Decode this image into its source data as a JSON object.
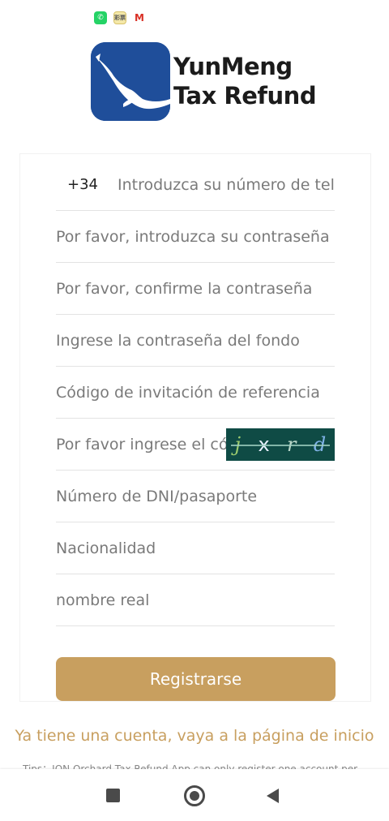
{
  "status_bar": {
    "icons": [
      "whatsapp-icon",
      "app-icon",
      "gmail-icon"
    ],
    "app_icon_text": "彩票",
    "gmail_icon_text": "M"
  },
  "logo": {
    "line1": "YunMeng",
    "line2": "Tax Refund"
  },
  "form": {
    "phone_prefix": "+34",
    "phone_placeholder": "Introduzca su número de teléf",
    "password_placeholder": "Por favor, introduzca su contraseña",
    "confirm_password_placeholder": "Por favor, confirme la contraseña",
    "fund_password_placeholder": "Ingrese la contraseña del fondo",
    "invitation_code_placeholder": "Código de invitación de referencia",
    "captcha_placeholder": "Por favor ingrese el cóc",
    "captcha_chars": [
      "j",
      "x",
      "r",
      "d"
    ],
    "id_placeholder": "Número de DNI/pasaporte",
    "nationality_placeholder": "Nacionalidad",
    "real_name_placeholder": "nombre real",
    "register_label": "Registrarse"
  },
  "login_link": "Ya tiene una cuenta, vaya a la página de inicio",
  "tips": "Tips：ION Orchard Tax Refund App can only register one account per",
  "colors": {
    "accent": "#c89f5f",
    "logo_blue": "#1f4e9a",
    "captcha_bg": "#0f4b45"
  }
}
